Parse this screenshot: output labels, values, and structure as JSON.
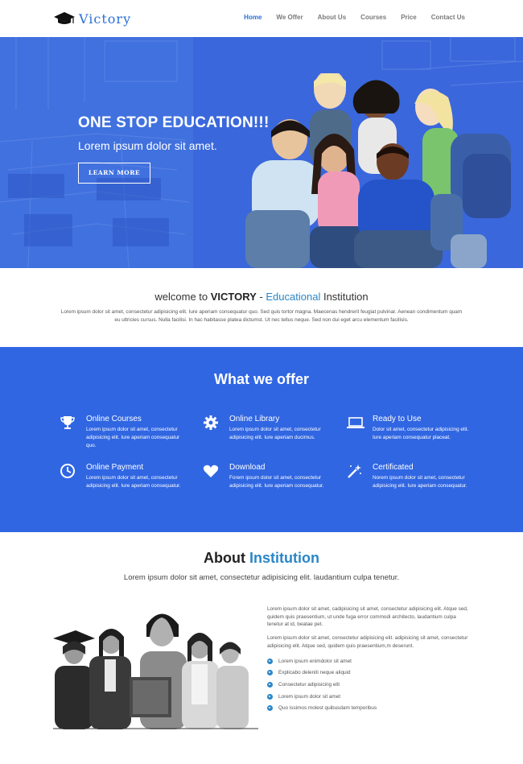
{
  "header": {
    "logo_text": "Victory",
    "logo_icon": "graduation-cap-icon",
    "nav": [
      {
        "label": "Home",
        "active": true
      },
      {
        "label": "We Offer",
        "active": false
      },
      {
        "label": "About Us",
        "active": false
      },
      {
        "label": "Courses",
        "active": false
      },
      {
        "label": "Price",
        "active": false
      },
      {
        "label": "Contact Us",
        "active": false
      }
    ]
  },
  "hero": {
    "title": "ONE STOP EDUCATION!!!",
    "subtitle": "Lorem ipsum dolor sit amet.",
    "button_label": "LEARN MORE"
  },
  "welcome": {
    "title_prefix": "welcome to ",
    "title_brand": "VICTORY",
    "title_dash": " - ",
    "title_highlight": "Educational",
    "title_suffix": " Institution",
    "text": "Lorem ipsum dolor sit amet, consectetur adipisicing elit. Iure aperiam consequatur quo. Sed quis tortor magna. Maecenas hendrerit feugiat pulvinar. Aenean condimentum quam eu ultricies cursus. Nulla facilisi. In hac habitasse platea dictumst. Ut nec tellus neque. Sed non dui eget arcu elementum facilisis."
  },
  "offer": {
    "title": "What we offer",
    "features": [
      {
        "icon": "trophy-icon",
        "title": "Online Courses",
        "text": "Lorem ipsum dolor sit amet, consectetur adipisicing elit. Iure aperiam consequatur quo."
      },
      {
        "icon": "gear-icon",
        "title": "Online Library",
        "text": "Lorem ipsum dolor sit amet, consectetur adipisicing elit. Iure aperiam ducimus."
      },
      {
        "icon": "laptop-icon",
        "title": "Ready to Use",
        "text": "Dolor sit amet, consectetur adipisicing elit. Iure aperiam consequatur placeat."
      },
      {
        "icon": "clock-icon",
        "title": "Online Payment",
        "text": "Lorem ipsum dolor sit amet, consectetur adipisicing elit. Iure aperiam consequatur."
      },
      {
        "icon": "heart-icon",
        "title": "Download",
        "text": "Forem ipsum dolor sit amet, consectetur adipisicing elit. Iure aperiam consequatur."
      },
      {
        "icon": "magic-wand-icon",
        "title": "Certificated",
        "text": "Norem ipsum dolor sit amet, consectetur adipisicing elit. Iure aperiam consequatur."
      }
    ]
  },
  "about": {
    "title_prefix": "About ",
    "title_highlight": "Institution",
    "subtitle": "Lorem ipsum dolor sit amet, consectetur adipisicing elit. laudantium culpa tenetur.",
    "paragraphs": [
      "Lorem ipsum dolor sit amet, cadipisicing sit amet, consectetur adipisicing elit. Atque sed, quidem quis praesentium, ut unde fuga error commodi architecto, laudantium culpa tenetur at id, beatae pet.",
      "Lorem ipsum dolor sit amet, consectetur adipisicing elit. adipisicing sit amet, consectetur adipisicing elit. Atque sed, quidem quis praesentium,m deserunt."
    ],
    "list": [
      "Lorem ipsum enimdolor sit amet",
      "Explicabo deleniti neque aliquid",
      "Consectetur adipisicing elit",
      "Lorem ipsum dolor sit amet",
      "Quo issimos molest quibusdam temporibus"
    ]
  },
  "colors": {
    "primary_blue": "#3066e2",
    "accent_blue": "#2a86c8",
    "nav_active": "#2a6fd8"
  }
}
